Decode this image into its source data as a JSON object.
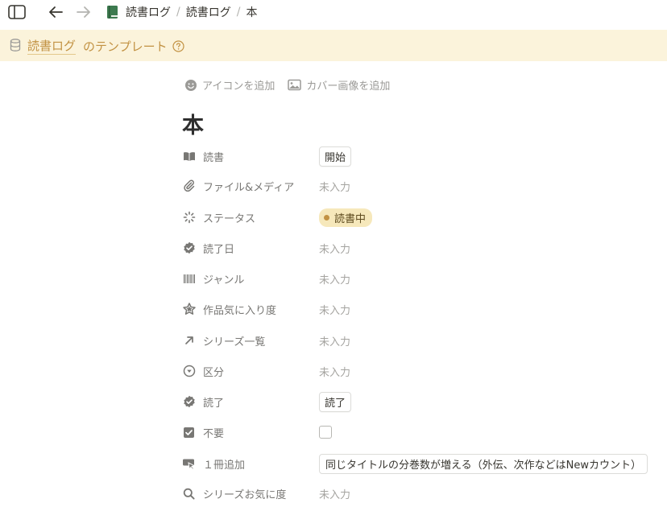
{
  "breadcrumb": {
    "items": [
      "読書ログ",
      "読書ログ",
      "本"
    ],
    "separator": "/"
  },
  "banner": {
    "db_name": "読書ログ",
    "suffix": "のテンプレート",
    "bg_color": "#fbf3db",
    "text_color": "#c29243"
  },
  "page_actions": {
    "add_icon": "アイコンを追加",
    "add_cover": "カバー画像を追加"
  },
  "page": {
    "title": "本"
  },
  "properties": [
    {
      "name": "読書",
      "icon": "book-open-icon",
      "value": "開始",
      "kind": "button"
    },
    {
      "name": "ファイル&メディア",
      "icon": "paperclip-icon",
      "value": "未入力",
      "kind": "empty"
    },
    {
      "name": "ステータス",
      "icon": "status-loader-icon",
      "value": "読書中",
      "kind": "status",
      "color": "#c29243"
    },
    {
      "name": "読了日",
      "icon": "verified-badge-icon",
      "value": "未入力",
      "kind": "empty"
    },
    {
      "name": "ジャンル",
      "icon": "barcode-icon",
      "value": "未入力",
      "kind": "empty"
    },
    {
      "name": "作品気に入り度",
      "icon": "star-icon",
      "value": "未入力",
      "kind": "empty"
    },
    {
      "name": "シリーズ一覧",
      "icon": "arrow-up-right-icon",
      "value": "未入力",
      "kind": "empty"
    },
    {
      "name": "区分",
      "icon": "select-circle-icon",
      "value": "未入力",
      "kind": "empty"
    },
    {
      "name": "読了",
      "icon": "verified-badge-icon",
      "value": "読了",
      "kind": "button"
    },
    {
      "name": "不要",
      "icon": "checkbox-icon",
      "value": false,
      "kind": "checkbox"
    },
    {
      "name": "１冊追加",
      "icon": "cursor-click-icon",
      "value": "同じタイトルの分巻数が増える（外伝、次作などはNewカウント）",
      "kind": "button"
    },
    {
      "name": "シリーズお気に度",
      "icon": "search-icon",
      "value": "未入力",
      "kind": "empty"
    }
  ]
}
